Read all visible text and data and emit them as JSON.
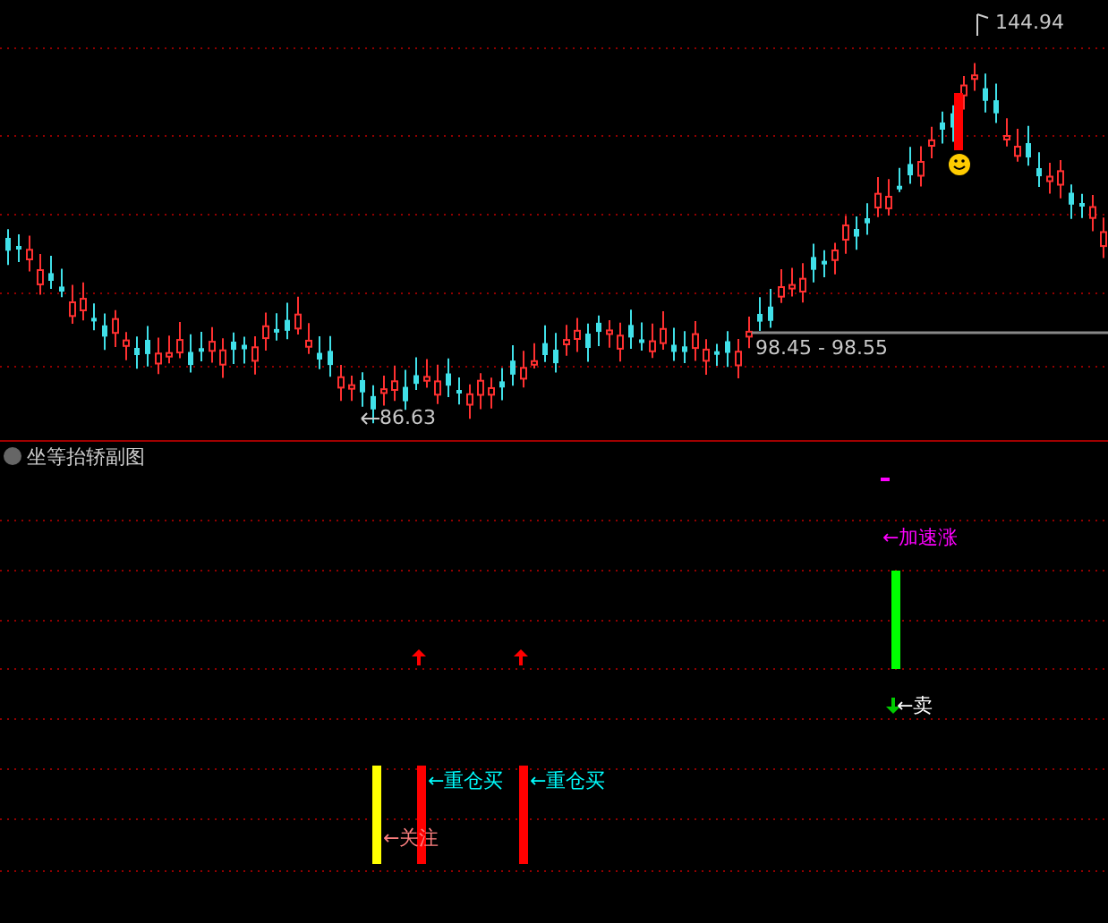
{
  "main_chart": {
    "high_label": "144.94",
    "range_label": "98.45 - 98.55",
    "low_label": "86.63"
  },
  "sub_chart": {
    "title": "坐等抬轿副图",
    "signals": [
      {
        "kind": "dash",
        "color": "#ff00ff"
      },
      {
        "kind": "label",
        "color": "#ff00ff",
        "text": "←加速涨"
      },
      {
        "kind": "bar",
        "color": "#00ff00"
      },
      {
        "kind": "arrow-down",
        "color": "#00cc00"
      },
      {
        "kind": "label",
        "color": "#ffffff",
        "text": "←卖"
      },
      {
        "kind": "arrow-up",
        "color": "#ff0000"
      },
      {
        "kind": "arrow-up",
        "color": "#ff0000"
      },
      {
        "kind": "bar",
        "color": "#ffff00"
      },
      {
        "kind": "label",
        "color": "#ff8080",
        "text": "←关注"
      },
      {
        "kind": "bar",
        "color": "#ff0000"
      },
      {
        "kind": "label",
        "color": "#00ffff",
        "text": "←重仓买"
      },
      {
        "kind": "bar",
        "color": "#ff0000"
      },
      {
        "kind": "label",
        "color": "#00ffff",
        "text": "←重仓买"
      }
    ]
  }
}
